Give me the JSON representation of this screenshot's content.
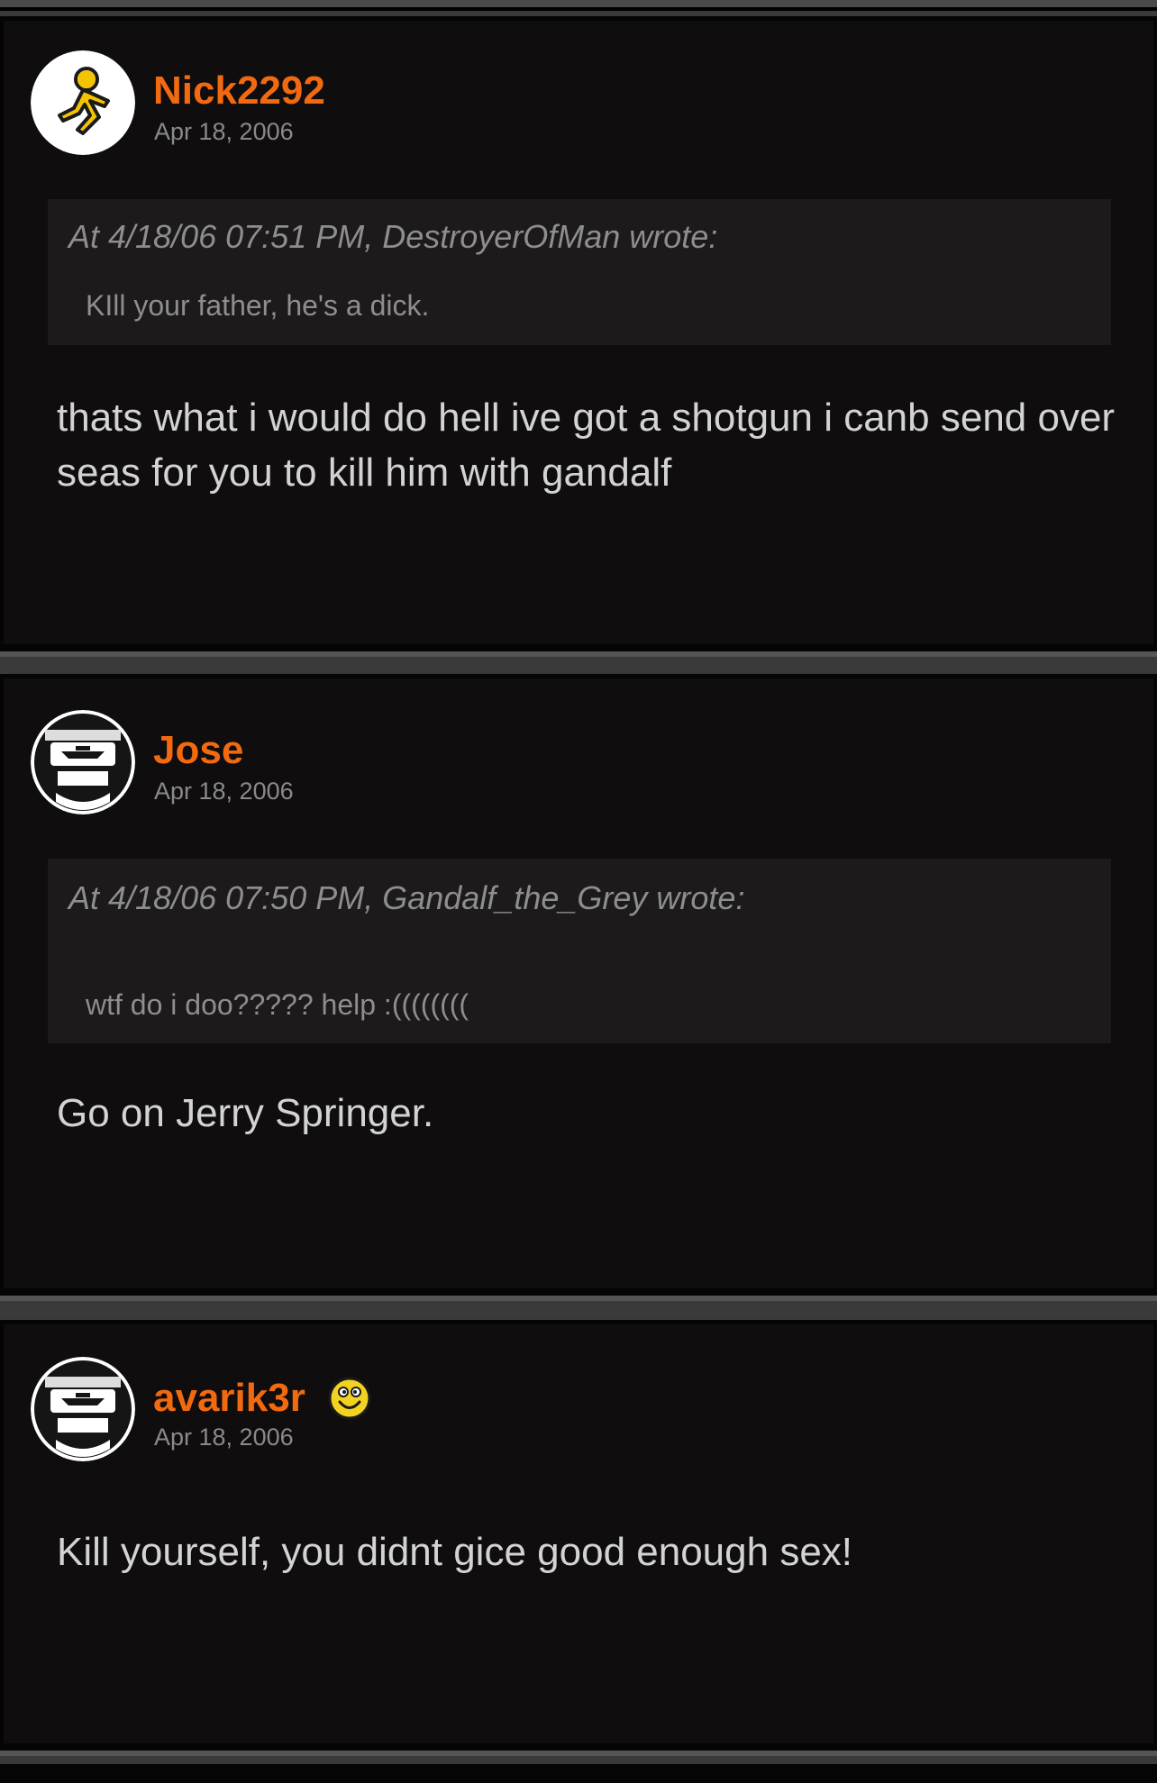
{
  "theme": {
    "accent": "#f26a10",
    "background": "#100d0e",
    "quote_background": "#1d1a1b",
    "text": "#d3d3d3",
    "muted_text": "#8a8a8a"
  },
  "posts": [
    {
      "username": "Nick2292",
      "date": "Apr 18, 2006",
      "avatar_icon": "aim-running-man-icon",
      "quote": {
        "header": "At 4/18/06 07:51 PM, DestroyerOfMan wrote:",
        "text": "KIll your father, he's a dick."
      },
      "body": "thats what i would do hell ive got a shotgun i canb send over seas for you to kill him with gandalf"
    },
    {
      "username": "Jose",
      "date": "Apr 18, 2006",
      "avatar_icon": "masked-face-icon",
      "quote": {
        "header": "At 4/18/06 07:50 PM, Gandalf_the_Grey wrote:",
        "text": "wtf do i doo????? help :(((((((("
      },
      "body": "Go on Jerry Springer."
    },
    {
      "username": "avarik3r",
      "date": "Apr 18, 2006",
      "avatar_icon": "masked-face-icon",
      "badge_icon": "smiley-icon",
      "body": "Kill yourself, you didnt gice good enough sex!"
    }
  ]
}
